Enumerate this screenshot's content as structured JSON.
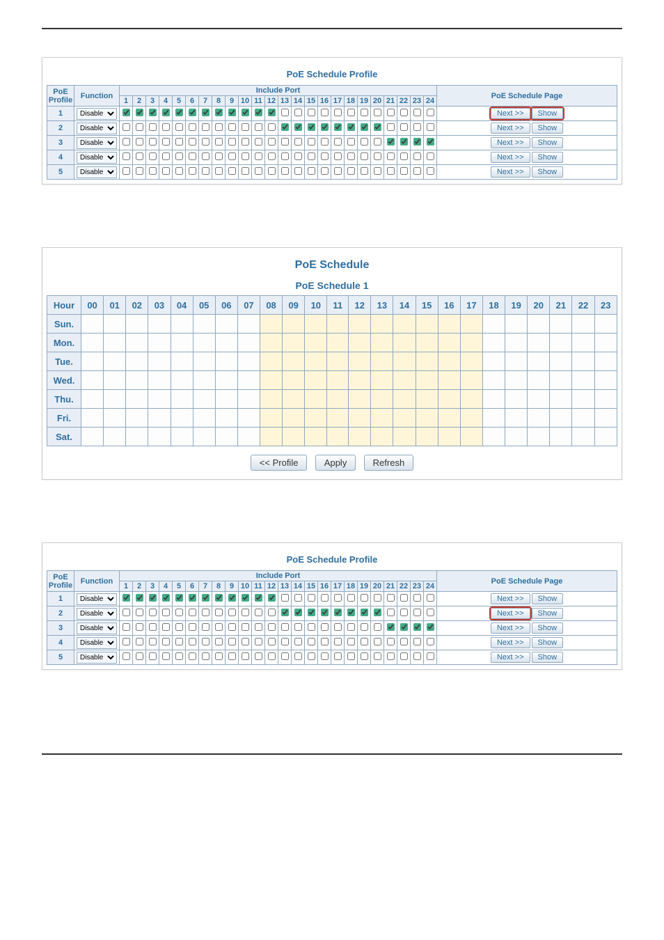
{
  "profile_panel": {
    "title": "PoE Schedule Profile",
    "head_profile": "PoE Profile",
    "head_function": "Function",
    "head_include_port": "Include Port",
    "head_page": "PoE Schedule Page",
    "port_nums": [
      "1",
      "2",
      "3",
      "4",
      "5",
      "6",
      "7",
      "8",
      "9",
      "10",
      "11",
      "12",
      "13",
      "14",
      "15",
      "16",
      "17",
      "18",
      "19",
      "20",
      "21",
      "22",
      "23",
      "24"
    ],
    "func_option": "Disable",
    "next_label": "Next >>",
    "show_label": "Show",
    "rows": [
      {
        "num": "1",
        "ports": [
          1,
          1,
          1,
          1,
          1,
          1,
          1,
          1,
          1,
          1,
          1,
          1,
          0,
          0,
          0,
          0,
          0,
          0,
          0,
          0,
          0,
          0,
          0,
          0
        ]
      },
      {
        "num": "2",
        "ports": [
          0,
          0,
          0,
          0,
          0,
          0,
          0,
          0,
          0,
          0,
          0,
          0,
          1,
          1,
          1,
          1,
          1,
          1,
          1,
          1,
          0,
          0,
          0,
          0
        ]
      },
      {
        "num": "3",
        "ports": [
          0,
          0,
          0,
          0,
          0,
          0,
          0,
          0,
          0,
          0,
          0,
          0,
          0,
          0,
          0,
          0,
          0,
          0,
          0,
          0,
          1,
          1,
          1,
          1
        ]
      },
      {
        "num": "4",
        "ports": [
          0,
          0,
          0,
          0,
          0,
          0,
          0,
          0,
          0,
          0,
          0,
          0,
          0,
          0,
          0,
          0,
          0,
          0,
          0,
          0,
          0,
          0,
          0,
          0
        ]
      },
      {
        "num": "5",
        "ports": [
          0,
          0,
          0,
          0,
          0,
          0,
          0,
          0,
          0,
          0,
          0,
          0,
          0,
          0,
          0,
          0,
          0,
          0,
          0,
          0,
          0,
          0,
          0,
          0
        ]
      }
    ]
  },
  "schedule_panel": {
    "title": "PoE Schedule",
    "subtitle": "PoE Schedule 1",
    "hour_label": "Hour",
    "hours": [
      "00",
      "01",
      "02",
      "03",
      "04",
      "05",
      "06",
      "07",
      "08",
      "09",
      "10",
      "11",
      "12",
      "13",
      "14",
      "15",
      "16",
      "17",
      "18",
      "19",
      "20",
      "21",
      "22",
      "23"
    ],
    "days": [
      "Sun.",
      "Mon.",
      "Tue.",
      "Wed.",
      "Thu.",
      "Fri.",
      "Sat."
    ],
    "btn_profile": "<< Profile",
    "btn_apply": "Apply",
    "btn_refresh": "Refresh"
  }
}
